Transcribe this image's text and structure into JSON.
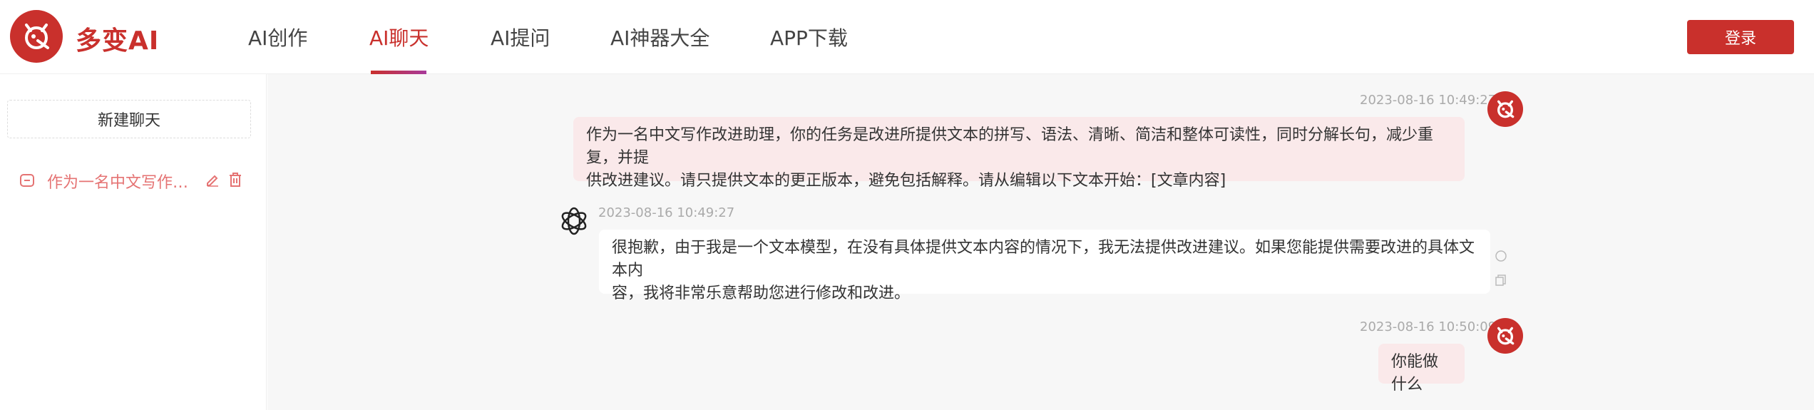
{
  "header": {
    "brand": "多变AI",
    "nav": [
      {
        "label": "AI创作"
      },
      {
        "label": "AI聊天",
        "active": true
      },
      {
        "label": "AI提问"
      },
      {
        "label": "AI神器大全"
      },
      {
        "label": "APP下载"
      }
    ],
    "login_label": "登录"
  },
  "sidebar": {
    "new_chat_label": "新建聊天",
    "history": [
      {
        "title": "作为一名中文写作…"
      }
    ]
  },
  "messages": [
    {
      "role": "user",
      "time": "2023-08-16 10:49:27",
      "text_lines": [
        "作为一名中文写作改进助理，你的任务是改进所提供文本的拼写、语法、清晰、简洁和整体可读性，同时分解长句，减少重复，并提",
        "供改进建议。请只提供文本的更正版本，避免包括解释。请从编辑以下文本开始：[文章内容]"
      ]
    },
    {
      "role": "assistant",
      "time": "2023-08-16 10:49:27",
      "text_lines": [
        "很抱歉，由于我是一个文本模型，在没有具体提供文本内容的情况下，我无法提供改进建议。如果您能提供需要改进的具体文本内",
        "容，我将非常乐意帮助您进行修改和改进。"
      ]
    },
    {
      "role": "user",
      "time": "2023-08-16 10:50:09",
      "text_lines": [
        "你能做什么"
      ]
    }
  ],
  "colors": {
    "brand": "#c9302c",
    "user_bubble": "#fae9ea",
    "main_bg": "#f7f7f7"
  }
}
